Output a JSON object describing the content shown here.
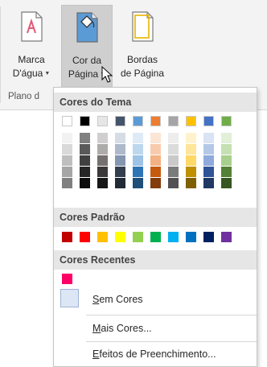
{
  "ribbon": {
    "watermark": {
      "line1": "Marca",
      "line2": "D'água",
      "icon": "watermark-icon"
    },
    "page_color": {
      "line1": "Cor da",
      "line2": "Página",
      "icon": "page-color-bucket-icon"
    },
    "page_borders": {
      "line1": "Bordas",
      "line2": "de Página",
      "icon": "page-borders-icon"
    },
    "group_label": "Plano d",
    "caret": "▼"
  },
  "menu": {
    "theme_colors_header": "Cores do Tema",
    "standard_colors_header": "Cores Padrão",
    "recent_colors_header": "Cores Recentes",
    "no_color_label": "Sem Cores",
    "more_colors_label": "Mais Cores...",
    "fill_effects_label": "Efeitos de Preenchimento...",
    "theme_colors": [
      {
        "base": "#ffffff",
        "shades": [
          "#f2f2f2",
          "#d9d9d9",
          "#bfbfbf",
          "#a6a6a6",
          "#808080"
        ]
      },
      {
        "base": "#000000",
        "shades": [
          "#808080",
          "#595959",
          "#404040",
          "#262626",
          "#0d0d0d"
        ]
      },
      {
        "base": "#e7e6e6",
        "shades": [
          "#d0cece",
          "#aeabab",
          "#757171",
          "#3a3838",
          "#171616"
        ]
      },
      {
        "base": "#44546a",
        "shades": [
          "#d6dce4",
          "#adb9ca",
          "#8496b0",
          "#333f4f",
          "#222a35"
        ]
      },
      {
        "base": "#5b9bd5",
        "shades": [
          "#deebf6",
          "#bdd7ee",
          "#9dc3e6",
          "#2e75b5",
          "#1f4e79"
        ]
      },
      {
        "base": "#ed7d31",
        "shades": [
          "#fbe5d5",
          "#f8cbad",
          "#f4b183",
          "#c55a11",
          "#833c0b"
        ]
      },
      {
        "base": "#a5a5a5",
        "shades": [
          "#ededed",
          "#dbdbdb",
          "#c9c9c9",
          "#7b7b7b",
          "#525252"
        ]
      },
      {
        "base": "#ffc000",
        "shades": [
          "#fff2cc",
          "#fee599",
          "#ffd965",
          "#bf9000",
          "#7f6000"
        ]
      },
      {
        "base": "#4472c4",
        "shades": [
          "#dae3f3",
          "#b4c7e7",
          "#8faadc",
          "#2f5597",
          "#1f3864"
        ]
      },
      {
        "base": "#70ad47",
        "shades": [
          "#e2efd9",
          "#c5e0b3",
          "#a8d08d",
          "#538135",
          "#375623"
        ]
      }
    ],
    "standard_colors": [
      "#c00000",
      "#ff0000",
      "#ffc000",
      "#ffff00",
      "#92d050",
      "#00b050",
      "#00b0f0",
      "#0070c0",
      "#002060",
      "#7030a0"
    ],
    "recent_colors": [
      "#ff0066"
    ]
  }
}
